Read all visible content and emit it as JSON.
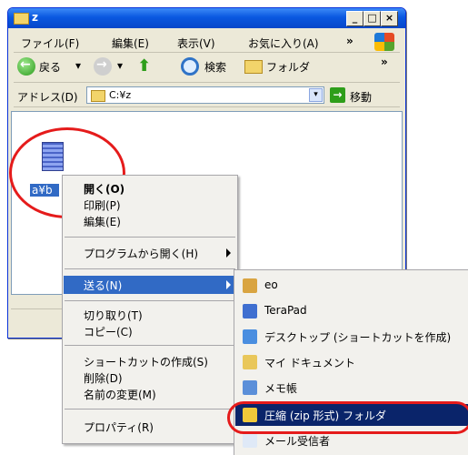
{
  "window": {
    "title": "z",
    "controls": [
      "_",
      "□",
      "×"
    ]
  },
  "menubar": {
    "items": [
      "ファイル(F)",
      "編集(E)",
      "表示(V)",
      "お気に入り(A)"
    ],
    "more": "»"
  },
  "toolbar": {
    "back_label": "戻る",
    "dropdown": "▾",
    "search_label": "検索",
    "folders_label": "フォルダ",
    "more": "»"
  },
  "addressbar": {
    "label": "アドレス(D)",
    "value": "C:¥z",
    "go_label": "移動"
  },
  "file": {
    "name": "a¥b"
  },
  "context_menu": {
    "items": [
      "開く(O)",
      "印刷(P)",
      "編集(E)",
      "プログラムから開く(H)",
      "送る(N)",
      "切り取り(T)",
      "コピー(C)",
      "ショートカットの作成(S)",
      "削除(D)",
      "名前の変更(M)",
      "プロパティ(R)"
    ]
  },
  "sendto_menu": {
    "items": [
      "eo",
      "TeraPad",
      "デスクトップ (ショートカットを作成)",
      "マイ ドキュメント",
      "メモ帳",
      "圧縮 (zip 形式) フォルダ",
      "メール受信者"
    ]
  },
  "colors": {
    "selection": "#316ac5",
    "submenu_selection": "#0a246a",
    "annotation_red": "#e51b1b"
  }
}
